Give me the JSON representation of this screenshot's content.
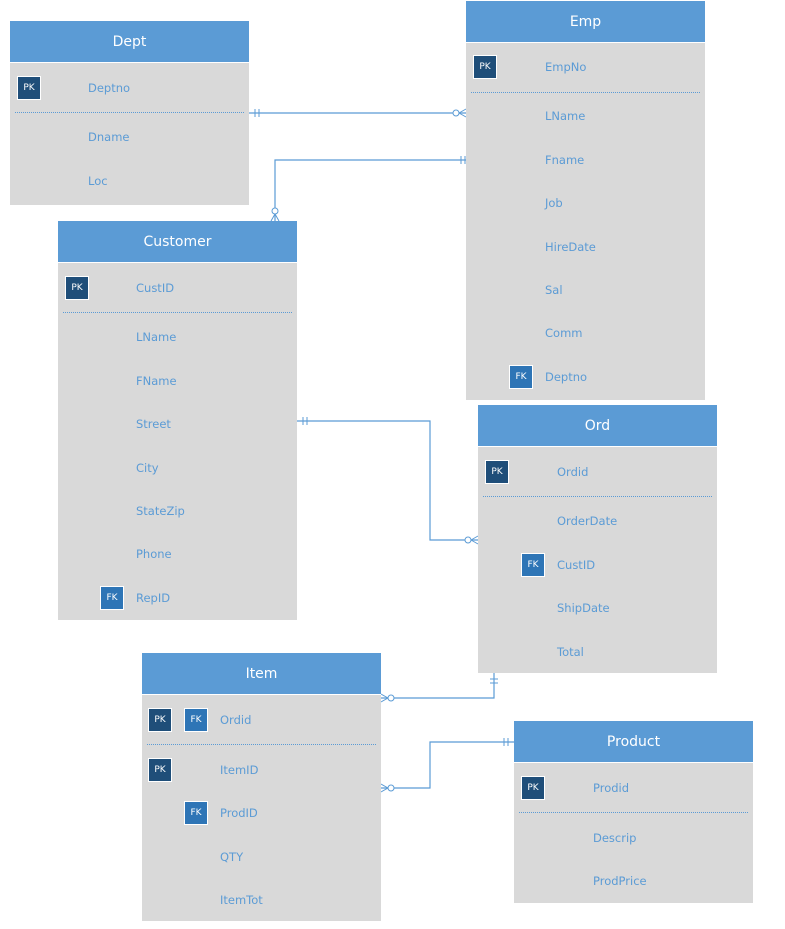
{
  "colors": {
    "header": "#5b9bd5",
    "body": "#d9d9d9",
    "pk_badge": "#1f4e79",
    "fk_badge": "#2e75b6",
    "text": "#5b9bd5",
    "line": "#5b9bd5"
  },
  "entities": [
    {
      "name": "Dept",
      "rows": [
        {
          "label": "Deptno",
          "pk": true
        },
        {
          "divider": true
        },
        {
          "label": "Dname"
        },
        {
          "label": "Loc"
        }
      ]
    },
    {
      "name": "Emp",
      "rows": [
        {
          "label": "EmpNo",
          "pk": true
        },
        {
          "divider": true
        },
        {
          "label": "LName"
        },
        {
          "label": "Fname"
        },
        {
          "label": "Job"
        },
        {
          "label": "HireDate"
        },
        {
          "label": "Sal"
        },
        {
          "label": "Comm"
        },
        {
          "label": "Deptno",
          "fk": true
        }
      ]
    },
    {
      "name": "Customer",
      "rows": [
        {
          "label": "CustID",
          "pk": true
        },
        {
          "divider": true
        },
        {
          "label": "LName"
        },
        {
          "label": "FName"
        },
        {
          "label": "Street"
        },
        {
          "label": "City"
        },
        {
          "label": "StateZip"
        },
        {
          "label": "Phone"
        },
        {
          "label": "RepID",
          "fk": true
        }
      ]
    },
    {
      "name": "Ord",
      "rows": [
        {
          "label": "Ordid",
          "pk": true
        },
        {
          "divider": true
        },
        {
          "label": "OrderDate"
        },
        {
          "label": "CustID",
          "fk": true
        },
        {
          "label": "ShipDate"
        },
        {
          "label": "Total"
        }
      ]
    },
    {
      "name": "Item",
      "rows": [
        {
          "label": "Ordid",
          "pk": true,
          "fk": true
        },
        {
          "divider": true
        },
        {
          "label": "ItemID",
          "pk": true
        },
        {
          "label": "ProdID",
          "fk": true
        },
        {
          "label": "QTY"
        },
        {
          "label": "ItemTot"
        }
      ]
    },
    {
      "name": "Product",
      "rows": [
        {
          "label": "Prodid",
          "pk": true
        },
        {
          "divider": true
        },
        {
          "label": "Descrip"
        },
        {
          "label": "ProdPrice"
        }
      ]
    }
  ],
  "badges": {
    "pk": "PK",
    "fk": "FK"
  },
  "relationships": [
    {
      "from": "Dept",
      "to": "Emp",
      "from_card": "one",
      "to_card": "zero-or-many"
    },
    {
      "from": "Emp",
      "to": "Customer",
      "from_card": "one",
      "to_card": "zero-or-many"
    },
    {
      "from": "Customer",
      "to": "Ord",
      "from_card": "one",
      "to_card": "zero-or-many"
    },
    {
      "from": "Ord",
      "to": "Item",
      "from_card": "one",
      "to_card": "zero-or-many"
    },
    {
      "from": "Product",
      "to": "Item",
      "from_card": "one",
      "to_card": "zero-or-many"
    }
  ]
}
